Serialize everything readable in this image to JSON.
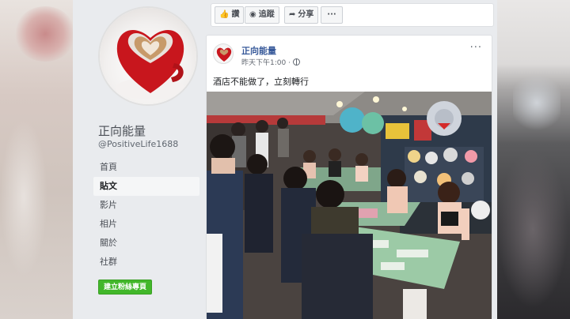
{
  "page": {
    "name": "正向能量",
    "handle": "@PositiveLife1688"
  },
  "nav": {
    "items": [
      {
        "label": "首頁",
        "active": false
      },
      {
        "label": "貼文",
        "active": true
      },
      {
        "label": "影片",
        "active": false
      },
      {
        "label": "相片",
        "active": false
      },
      {
        "label": "關於",
        "active": false
      },
      {
        "label": "社群",
        "active": false
      }
    ],
    "create_page_label": "建立粉絲專頁"
  },
  "action_bar": {
    "like_label": "讚",
    "follow_label": "追蹤",
    "share_label": "分享",
    "more_label": "···"
  },
  "post": {
    "author": "正向能量",
    "time": "昨天下午1:00 ·",
    "text": "酒店不能做了，立刻轉行",
    "menu_label": "···"
  },
  "colors": {
    "fb_background": "#e9ebee",
    "link_blue": "#365899",
    "create_button_green": "#42b72a"
  }
}
